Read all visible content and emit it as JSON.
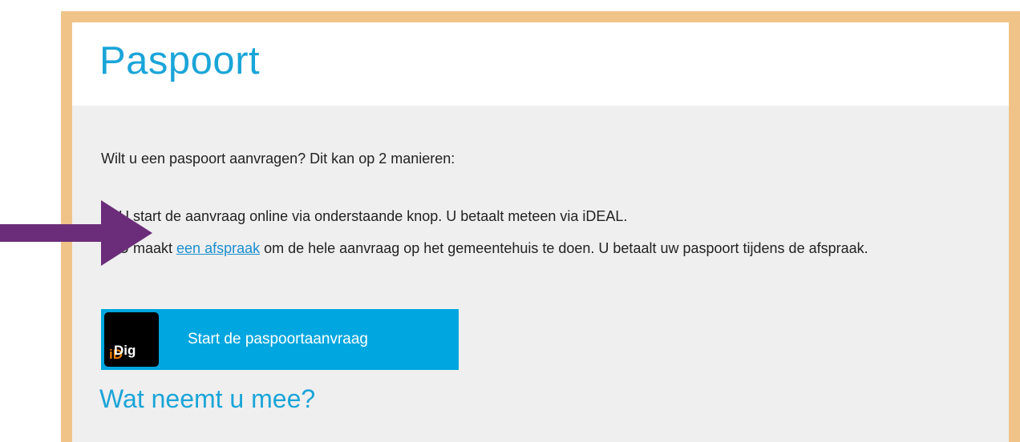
{
  "page": {
    "title": "Paspoort",
    "intro": "Wilt u een paspoort aanvragen? Dit kan op 2 manieren:",
    "options": [
      {
        "text": "U start de aanvraag online via onderstaande knop. U betaalt meteen via iDEAL."
      },
      {
        "text_before": "U maakt ",
        "link": "een afspraak",
        "text_after": " om de hele aanvraag op het gemeentehuis te doen. U betaalt uw paspoort tijdens de afspraak."
      }
    ],
    "button": {
      "logo_text_main": "Dig",
      "logo_text_accent": "iD",
      "label": "Start de paspoortaanvraag"
    },
    "subheading": "Wat neemt u mee?"
  },
  "icons": {
    "chevron": "chevron-right-icon",
    "annotation": "arrow-right-icon"
  },
  "colors": {
    "frame": "#f0c489",
    "accent": "#1aa5d8",
    "button": "#00a6df",
    "arrow": "#6b2d7a",
    "digid_accent": "#f07d00"
  }
}
